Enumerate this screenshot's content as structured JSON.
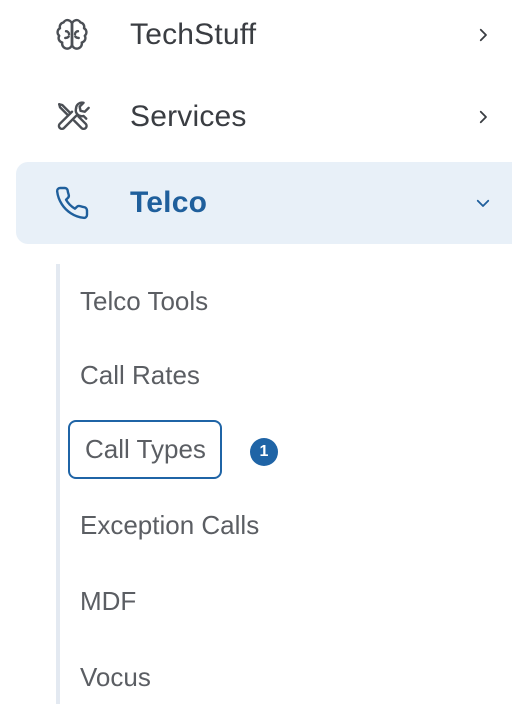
{
  "nav": {
    "items": [
      {
        "label": "TechStuff",
        "icon": "brain-icon",
        "expanded": false
      },
      {
        "label": "Services",
        "icon": "tools-icon",
        "expanded": false
      },
      {
        "label": "Telco",
        "icon": "phone-icon",
        "expanded": true
      }
    ]
  },
  "telco_submenu": {
    "items": [
      {
        "label": "Telco Tools"
      },
      {
        "label": "Call Rates"
      },
      {
        "label": "Call Types",
        "focused": true,
        "badge": "1"
      },
      {
        "label": "Exception Calls"
      },
      {
        "label": "MDF"
      },
      {
        "label": "Vocus"
      }
    ]
  },
  "colors": {
    "active_bg": "#e8f0f8",
    "active_text": "#1f5f9c",
    "badge_bg": "#1f64a6",
    "focus_ring": "#1f64a6",
    "text_default": "#3a3d42",
    "submenu_text": "#5b5e63"
  }
}
